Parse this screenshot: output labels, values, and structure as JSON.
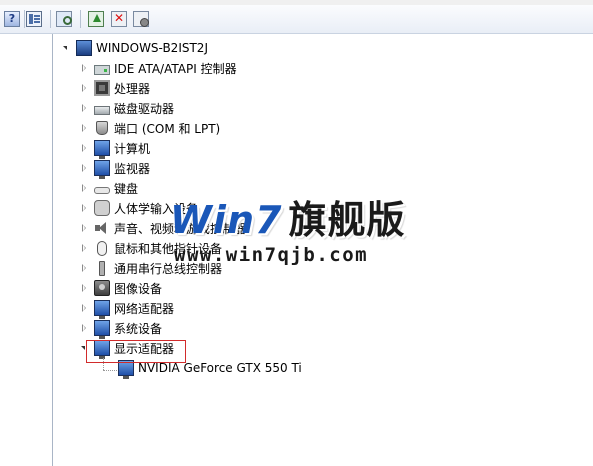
{
  "toolbar": {
    "buttons": [
      {
        "name": "help",
        "glyph": "?"
      },
      {
        "name": "show-hide-console-tree"
      },
      {
        "name": "scan-hardware-changes"
      },
      {
        "name": "update-driver"
      },
      {
        "name": "uninstall"
      },
      {
        "name": "disable"
      }
    ]
  },
  "tree": {
    "root": "WINDOWS-B2IST2J",
    "categories": [
      {
        "label": "IDE ATA/ATAPI 控制器",
        "icon": "ide-controller-icon"
      },
      {
        "label": "处理器",
        "icon": "processor-icon"
      },
      {
        "label": "磁盘驱动器",
        "icon": "disk-drive-icon"
      },
      {
        "label": "端口 (COM 和 LPT)",
        "icon": "port-icon"
      },
      {
        "label": "计算机",
        "icon": "computer-icon"
      },
      {
        "label": "监视器",
        "icon": "monitor-icon"
      },
      {
        "label": "键盘",
        "icon": "keyboard-icon"
      },
      {
        "label": "人体学输入设备",
        "icon": "hid-icon"
      },
      {
        "label": "声音、视频和游戏控制器",
        "icon": "sound-icon"
      },
      {
        "label": "鼠标和其他指针设备",
        "icon": "mouse-icon"
      },
      {
        "label": "通用串行总线控制器",
        "icon": "usb-icon"
      },
      {
        "label": "图像设备",
        "icon": "camera-icon"
      },
      {
        "label": "网络适配器",
        "icon": "network-adapter-icon"
      },
      {
        "label": "系统设备",
        "icon": "system-device-icon"
      },
      {
        "label": "显示适配器",
        "icon": "display-adapter-icon",
        "expanded": true
      }
    ],
    "child": {
      "label": "NVIDIA GeForce GTX 550 Ti",
      "icon": "display-adapter-icon"
    }
  },
  "watermark": {
    "brand": "Win7",
    "brand_cn": "旗舰版",
    "url": "www.win7qjb.com"
  },
  "colors": {
    "highlight_box": "#d12b2b",
    "watermark_blue": "#1a57b8"
  }
}
